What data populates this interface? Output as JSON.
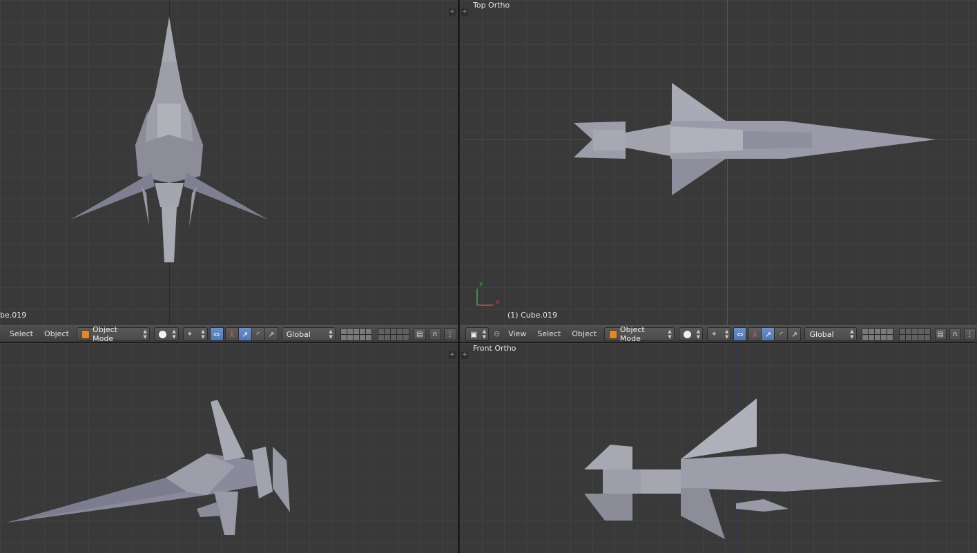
{
  "viewports": {
    "top_left": {
      "object_label": "be.019"
    },
    "top_right": {
      "view_label": "Top Ortho",
      "object_label": "(1) Cube.019"
    },
    "bottom_right": {
      "view_label": "Front Ortho"
    }
  },
  "header_left": {
    "menu": [
      "Select",
      "Object"
    ],
    "mode": "Object Mode",
    "orientation": "Global"
  },
  "header_right": {
    "menu": [
      "View",
      "Select",
      "Object"
    ],
    "mode": "Object Mode",
    "orientation": "Global"
  },
  "axis_widget": {
    "y_label": "y",
    "x_label": "x"
  },
  "icons": [
    "view3d-icon",
    "shading-sphere-icon",
    "pivot-icon",
    "manipulator-icon",
    "translate-icon",
    "rotate-icon",
    "scale-icon",
    "layers-icon",
    "lock-icon",
    "snap-magnet-icon",
    "render-icon"
  ],
  "colors": {
    "viewport_bg": "#393939",
    "x_axis": "#8a2f2f",
    "y_axis": "#2f8a2f",
    "z_axis": "#2a2acc",
    "selected_button": "#5078b5",
    "mesh": "#9a9aa8"
  }
}
